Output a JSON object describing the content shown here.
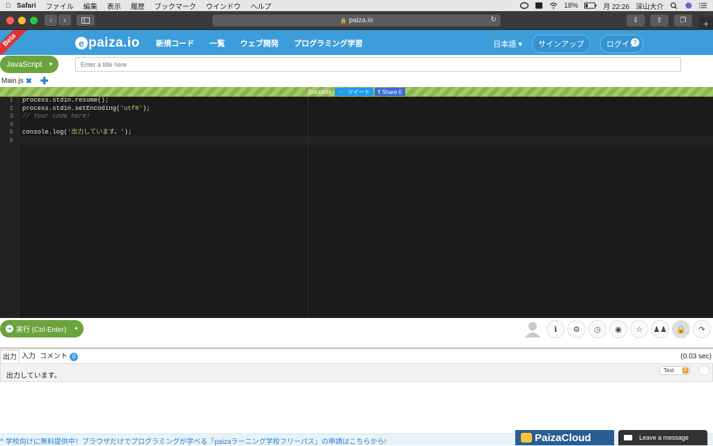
{
  "menubar": {
    "app": "Safari",
    "items": [
      "ファイル",
      "編集",
      "表示",
      "履歴",
      "ブックマーク",
      "ウインドウ",
      "ヘルプ"
    ],
    "battery": "18%",
    "datetime": "月 22:26",
    "user": "深山大介"
  },
  "browser": {
    "address": "paiza.io"
  },
  "header": {
    "beta": "Beta",
    "logo": "paiza.io",
    "nav": [
      "新規コード",
      "一覧",
      "ウェブ開発",
      "プログラミング学習"
    ],
    "language": "日本語",
    "signup": "サインアップ",
    "login": "ログイン",
    "help": "?"
  },
  "editor_bar": {
    "language_button": "JavaScript",
    "title_placeholder": "Enter a title here"
  },
  "tabs": {
    "file": "Main.js"
  },
  "status": {
    "text": "Success",
    "tweet": "ツイート",
    "share": "Share 0"
  },
  "code": {
    "line_numbers": [
      "1",
      "2",
      "3",
      "4",
      "5",
      "6"
    ],
    "lines": [
      "process.stdin.resume();",
      "process.stdin.setEncoding(",
      "// Your code here!",
      "",
      "console.log(",
      ""
    ],
    "line2_string": "'utf8'",
    "line2_end": ");",
    "line5_string": "'出力しています。'",
    "line5_end": ");"
  },
  "run": {
    "label": "実行 (Ctrl-Enter)"
  },
  "output": {
    "tabs": [
      "出力",
      "入力",
      "コメント"
    ],
    "comment_count": "0",
    "time": "(0.03 sec)",
    "text": "出力しています。",
    "format": "Text"
  },
  "footer": {
    "close": "×",
    "banner": "学校向けに無料提供中！ブラウザだけでプログラミングが学べる「paizaラーニング学校フリーパス」の申請はこちらから!",
    "cloud": "PaizaCloud",
    "message": "Leave a message"
  },
  "colors": {
    "header_blue": "#3d9ddb",
    "run_green": "#6ba33c",
    "beta_red": "#d9343a",
    "editor_bg": "#1b1b1b"
  }
}
